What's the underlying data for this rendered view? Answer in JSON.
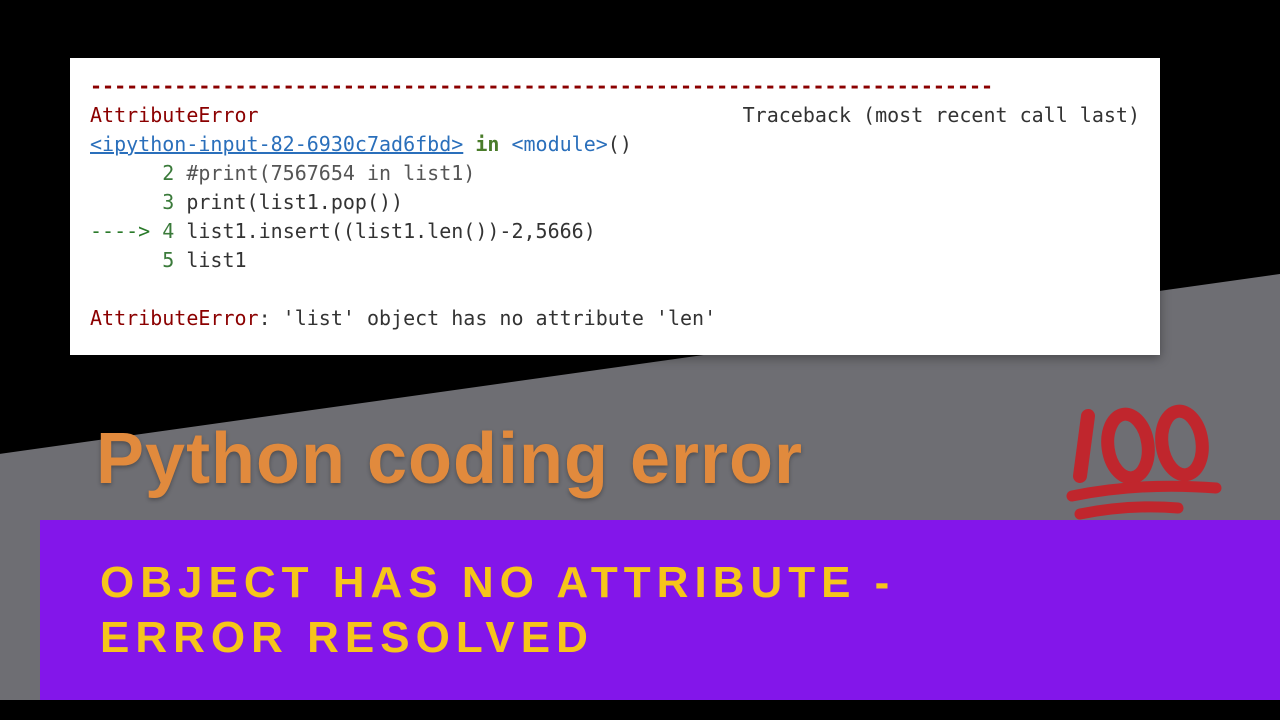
{
  "code": {
    "dashes": "---------------------------------------------------------------------------",
    "error_name": "AttributeError",
    "traceback_label": "Traceback (most recent call last)",
    "source_link": "<ipython-input-82-6930c7ad6fbd>",
    "in_word": "in",
    "module": "<module>",
    "module_call": "()",
    "line2_no": "2",
    "line2_code": "#print(7567654 in list1)",
    "line3_no": "3",
    "line3_code": "print(list1.pop())",
    "arrow": "---->",
    "line4_no": "4",
    "line4_code": "list1.insert((list1.len())-2,5666)",
    "line5_no": "5",
    "line5_code": "list1",
    "error_label": "AttributeError",
    "error_message": ": 'list' object has no attribute 'len'"
  },
  "title": "Python coding error",
  "subtitle_line1": "OBJECT HAS NO ATTRIBUTE -",
  "subtitle_line2": "ERROR RESOLVED",
  "emoji_label": "100"
}
